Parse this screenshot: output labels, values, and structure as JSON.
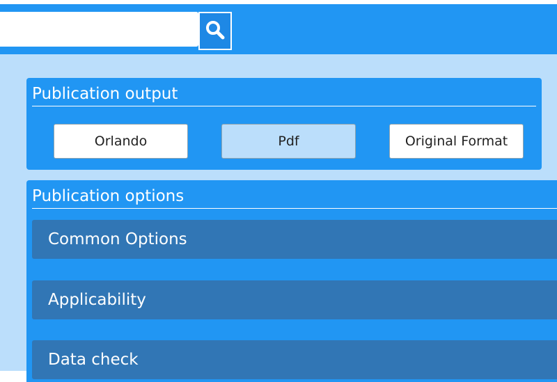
{
  "header": {
    "search": {
      "value": "",
      "placeholder": ""
    },
    "search_button_icon": "search-icon"
  },
  "publication_output": {
    "title": "Publication output",
    "formats": [
      {
        "label": "Orlando",
        "selected": false
      },
      {
        "label": "Pdf",
        "selected": true
      },
      {
        "label": "Original Format",
        "selected": false
      }
    ]
  },
  "publication_options": {
    "title": "Publication options",
    "sections": [
      {
        "label": "Common Options"
      },
      {
        "label": "Applicability"
      },
      {
        "label": "Data check"
      }
    ]
  },
  "colors": {
    "primary": "#2196f3",
    "background": "#bbdefb",
    "section": "#3176b5",
    "selected": "#bbdefb"
  }
}
